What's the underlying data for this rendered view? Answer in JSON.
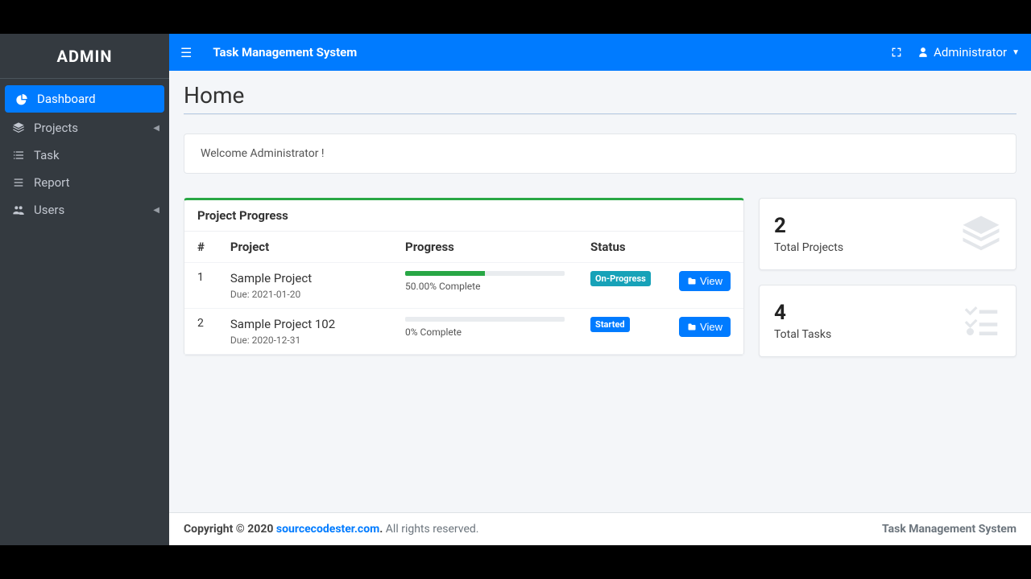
{
  "brand": "ADMIN",
  "topbar": {
    "title": "Task Management System",
    "user": "Administrator"
  },
  "sidebar": {
    "items": [
      {
        "label": "Dashboard",
        "icon": "dashboard",
        "active": true,
        "has_children": false
      },
      {
        "label": "Projects",
        "icon": "layers",
        "active": false,
        "has_children": true
      },
      {
        "label": "Task",
        "icon": "tasks",
        "active": false,
        "has_children": false
      },
      {
        "label": "Report",
        "icon": "list",
        "active": false,
        "has_children": false
      },
      {
        "label": "Users",
        "icon": "users",
        "active": false,
        "has_children": true
      }
    ]
  },
  "page": {
    "title": "Home",
    "welcome": "Welcome Administrator !"
  },
  "progress_card": {
    "title": "Project Progress",
    "columns": {
      "num": "#",
      "project": "Project",
      "progress": "Progress",
      "status": "Status"
    },
    "view_label": "View",
    "rows": [
      {
        "index": "1",
        "name": "Sample Project",
        "due_prefix": "Due: ",
        "due": "2021-01-20",
        "pct": 50,
        "pct_text": "50.00% Complete",
        "status": "On-Progress",
        "status_style": "teal"
      },
      {
        "index": "2",
        "name": "Sample Project 102",
        "due_prefix": "Due: ",
        "due": "2020-12-31",
        "pct": 0,
        "pct_text": "0% Complete",
        "status": "Started",
        "status_style": "blue"
      }
    ]
  },
  "stats": [
    {
      "value": "2",
      "label": "Total Projects",
      "icon": "layers"
    },
    {
      "value": "4",
      "label": "Total Tasks",
      "icon": "tasks"
    }
  ],
  "footer": {
    "copyright_prefix": "Copyright © 2020 ",
    "link": "sourcecodester.com",
    "copyright_suffix": ". ",
    "rights": "All rights reserved.",
    "right": "Task Management System"
  }
}
